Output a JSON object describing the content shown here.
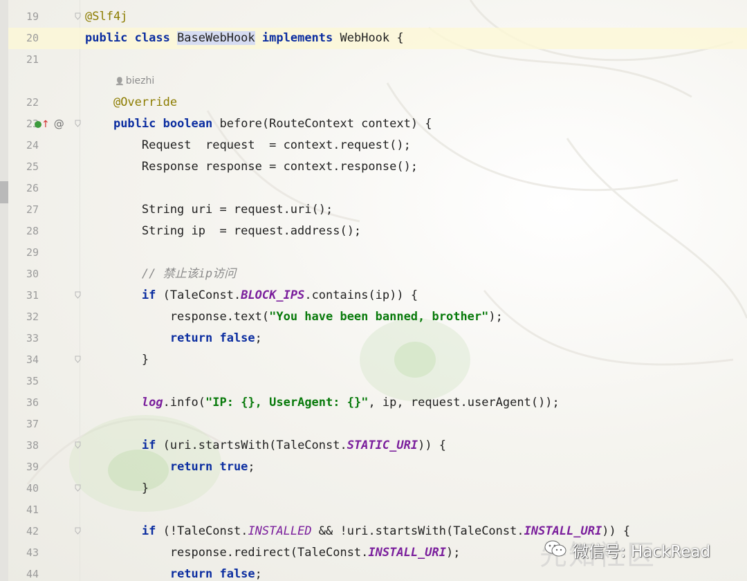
{
  "editor": {
    "lines": [
      {
        "num": "19",
        "segments": [
          {
            "cls": "ann",
            "text": "@Slf4j"
          }
        ]
      },
      {
        "num": "20",
        "segments": [
          {
            "cls": "kw",
            "text": "public class "
          },
          {
            "cls": "hl",
            "text": "BaseWebHook"
          },
          {
            "cls": "",
            "text": " "
          },
          {
            "cls": "kw",
            "text": "implements"
          },
          {
            "cls": "",
            "text": " WebHook {"
          }
        ]
      },
      {
        "num": "21",
        "segments": []
      },
      {
        "num": "",
        "author": "biezhi"
      },
      {
        "num": "22",
        "segments": [
          {
            "cls": "",
            "text": "    "
          },
          {
            "cls": "ann",
            "text": "@Override"
          }
        ]
      },
      {
        "num": "23",
        "segments": [
          {
            "cls": "",
            "text": "    "
          },
          {
            "cls": "kw",
            "text": "public boolean"
          },
          {
            "cls": "",
            "text": " before(RouteContext context) {"
          }
        ]
      },
      {
        "num": "24",
        "segments": [
          {
            "cls": "",
            "text": "        Request  request  = context.request();"
          }
        ]
      },
      {
        "num": "25",
        "segments": [
          {
            "cls": "",
            "text": "        Response response = context.response();"
          }
        ]
      },
      {
        "num": "26",
        "segments": []
      },
      {
        "num": "27",
        "segments": [
          {
            "cls": "",
            "text": "        String uri = request.uri();"
          }
        ]
      },
      {
        "num": "28",
        "segments": [
          {
            "cls": "",
            "text": "        String ip  = request.address();"
          }
        ]
      },
      {
        "num": "29",
        "segments": []
      },
      {
        "num": "30",
        "segments": [
          {
            "cls": "",
            "text": "        "
          },
          {
            "cls": "cmt",
            "text": "// 禁止该ip访问"
          }
        ]
      },
      {
        "num": "31",
        "segments": [
          {
            "cls": "",
            "text": "        "
          },
          {
            "cls": "kw",
            "text": "if"
          },
          {
            "cls": "",
            "text": " (TaleConst."
          },
          {
            "cls": "cst",
            "text": "BLOCK_IPS"
          },
          {
            "cls": "",
            "text": ".contains(ip)) {"
          }
        ]
      },
      {
        "num": "32",
        "segments": [
          {
            "cls": "",
            "text": "            response.text("
          },
          {
            "cls": "str",
            "text": "\"You have been banned, brother\""
          },
          {
            "cls": "",
            "text": ");"
          }
        ]
      },
      {
        "num": "33",
        "segments": [
          {
            "cls": "",
            "text": "            "
          },
          {
            "cls": "kw",
            "text": "return false"
          },
          {
            "cls": "",
            "text": ";"
          }
        ]
      },
      {
        "num": "34",
        "segments": [
          {
            "cls": "",
            "text": "        }"
          }
        ]
      },
      {
        "num": "35",
        "segments": []
      },
      {
        "num": "36",
        "segments": [
          {
            "cls": "",
            "text": "        "
          },
          {
            "cls": "fld",
            "text": "log"
          },
          {
            "cls": "",
            "text": ".info("
          },
          {
            "cls": "str",
            "text": "\"IP: {}, UserAgent: {}\""
          },
          {
            "cls": "",
            "text": ", ip, request.userAgent());"
          }
        ]
      },
      {
        "num": "37",
        "segments": []
      },
      {
        "num": "38",
        "segments": [
          {
            "cls": "",
            "text": "        "
          },
          {
            "cls": "kw",
            "text": "if"
          },
          {
            "cls": "",
            "text": " (uri.startsWith(TaleConst."
          },
          {
            "cls": "cst",
            "text": "STATIC_URI"
          },
          {
            "cls": "",
            "text": ")) {"
          }
        ]
      },
      {
        "num": "39",
        "segments": [
          {
            "cls": "",
            "text": "            "
          },
          {
            "cls": "kw",
            "text": "return true"
          },
          {
            "cls": "",
            "text": ";"
          }
        ]
      },
      {
        "num": "40",
        "segments": [
          {
            "cls": "",
            "text": "        }"
          }
        ]
      },
      {
        "num": "41",
        "segments": []
      },
      {
        "num": "42",
        "segments": [
          {
            "cls": "",
            "text": "        "
          },
          {
            "cls": "kw",
            "text": "if"
          },
          {
            "cls": "",
            "text": " (!TaleConst."
          },
          {
            "cls": "cst-soft",
            "text": "INSTALLED"
          },
          {
            "cls": "",
            "text": " && !uri.startsWith(TaleConst."
          },
          {
            "cls": "cst",
            "text": "INSTALL_URI"
          },
          {
            "cls": "",
            "text": ")) {"
          }
        ]
      },
      {
        "num": "43",
        "segments": [
          {
            "cls": "",
            "text": "            response.redirect(TaleConst."
          },
          {
            "cls": "cst",
            "text": "INSTALL_URI"
          },
          {
            "cls": "",
            "text": ");"
          }
        ]
      },
      {
        "num": "44",
        "segments": [
          {
            "cls": "",
            "text": "            "
          },
          {
            "cls": "kw",
            "text": "return false"
          },
          {
            "cls": "",
            "text": ";"
          }
        ]
      }
    ],
    "gutter_icons": {
      "line": "23",
      "icons": [
        "implementing-method-icon",
        "override-up-arrow-icon",
        "annotation-at-icon"
      ]
    },
    "fold_lines": [
      "19",
      "23",
      "31",
      "34",
      "38",
      "40",
      "42"
    ]
  },
  "watermark": {
    "text": "微信号: HackRead",
    "faded_text": "先知社区"
  },
  "colors": {
    "keyword": "#0b2da0",
    "annotation": "#8c7c00",
    "string": "#087a0b",
    "constant": "#7a1e9c",
    "comment": "#8c8c8c",
    "current_line": "#fcf7d6",
    "selection": "#d6dcf2"
  }
}
